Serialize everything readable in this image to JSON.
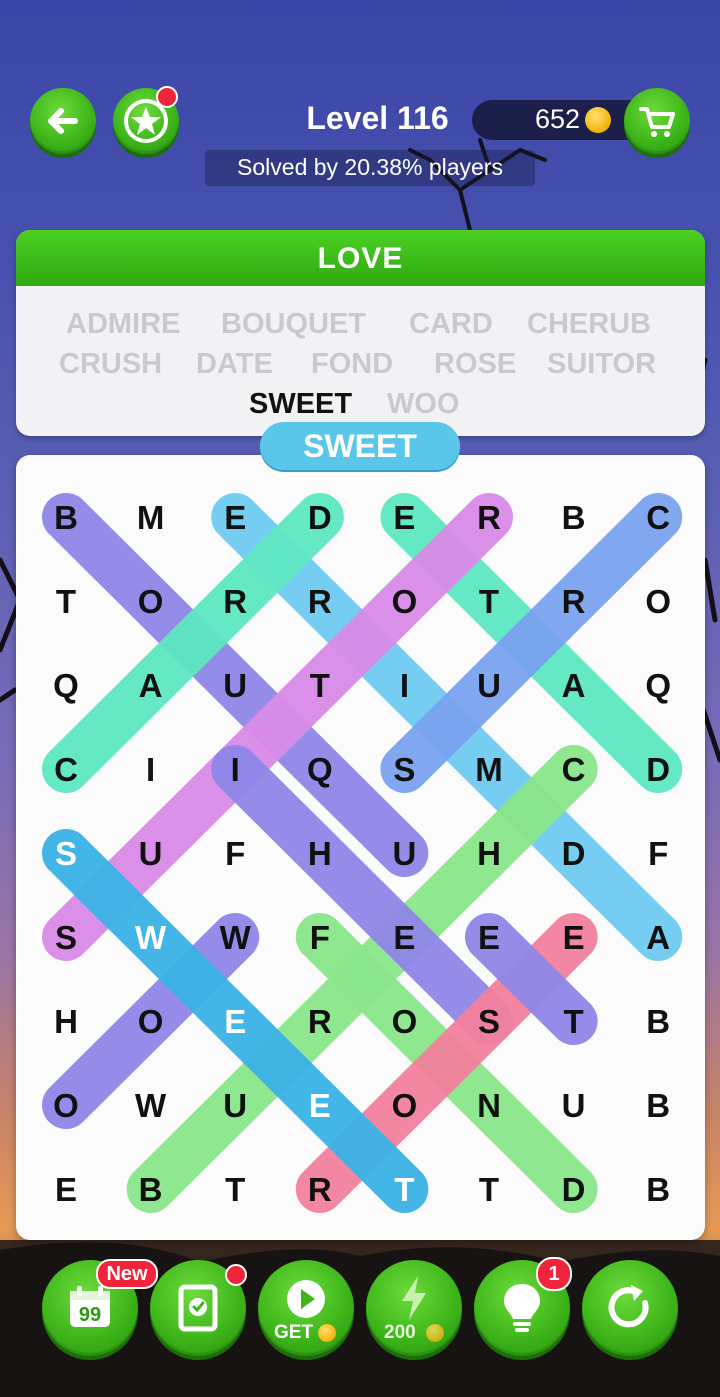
{
  "header": {
    "level_title": "Level 116",
    "coins": "652",
    "solved_text": "Solved by 20.38% players"
  },
  "category": "LOVE",
  "words": [
    {
      "text": "ADMIRE",
      "found": false
    },
    {
      "text": "BOUQUET",
      "found": false
    },
    {
      "text": "CARD",
      "found": false
    },
    {
      "text": "CHERUB",
      "found": false
    },
    {
      "text": "CRUSH",
      "found": false
    },
    {
      "text": "DATE",
      "found": false
    },
    {
      "text": "FOND",
      "found": false
    },
    {
      "text": "ROSE",
      "found": false
    },
    {
      "text": "SUITOR",
      "found": false
    },
    {
      "text": "SWEET",
      "found": true
    },
    {
      "text": "WOO",
      "found": false
    }
  ],
  "current_word": "SWEET",
  "grid": [
    [
      "B",
      "M",
      "E",
      "D",
      "E",
      "R",
      "B",
      "C"
    ],
    [
      "T",
      "O",
      "R",
      "R",
      "O",
      "T",
      "R",
      "O"
    ],
    [
      "Q",
      "A",
      "U",
      "T",
      "I",
      "U",
      "A",
      "Q"
    ],
    [
      "C",
      "I",
      "I",
      "Q",
      "S",
      "M",
      "C",
      "D"
    ],
    [
      "S",
      "U",
      "F",
      "H",
      "U",
      "H",
      "D",
      "F"
    ],
    [
      "S",
      "W",
      "W",
      "F",
      "E",
      "E",
      "E",
      "A"
    ],
    [
      "H",
      "O",
      "E",
      "R",
      "O",
      "S",
      "T",
      "B"
    ],
    [
      "O",
      "W",
      "U",
      "E",
      "O",
      "N",
      "U",
      "B"
    ],
    [
      "E",
      "B",
      "T",
      "R",
      "T",
      "T",
      "D",
      "B"
    ]
  ],
  "highlights": [
    {
      "from": [
        0,
        0
      ],
      "to": [
        4,
        4
      ],
      "color": "#8f87e8"
    },
    {
      "from": [
        0,
        2
      ],
      "to": [
        5,
        7
      ],
      "color": "#6fcbf2"
    },
    {
      "from": [
        0,
        4
      ],
      "to": [
        3,
        7
      ],
      "color": "#5ee8c2"
    },
    {
      "from": [
        0,
        7
      ],
      "to": [
        3,
        4
      ],
      "color": "#7aa3f0"
    },
    {
      "from": [
        0,
        3
      ],
      "to": [
        3,
        0
      ],
      "color": "#5ee8c2"
    },
    {
      "from": [
        0,
        5
      ],
      "to": [
        5,
        0
      ],
      "color": "#d98be8"
    },
    {
      "from": [
        3,
        6
      ],
      "to": [
        8,
        1
      ],
      "color": "#8ae68a"
    },
    {
      "from": [
        3,
        2
      ],
      "to": [
        6,
        5
      ],
      "color": "#8f87e8"
    },
    {
      "from": [
        5,
        3
      ],
      "to": [
        8,
        6
      ],
      "color": "#8ae68a"
    },
    {
      "from": [
        5,
        6
      ],
      "to": [
        8,
        3
      ],
      "color": "#f3819e"
    },
    {
      "from": [
        5,
        5
      ],
      "to": [
        6,
        6
      ],
      "color": "#8f87e8"
    },
    {
      "from": [
        5,
        2
      ],
      "to": [
        7,
        0
      ],
      "color": "#8f87e8"
    },
    {
      "from": [
        4,
        0
      ],
      "to": [
        8,
        4
      ],
      "color": "#3bb2e6"
    }
  ],
  "white_cells": [
    [
      4,
      0
    ],
    [
      5,
      1
    ],
    [
      6,
      2
    ],
    [
      7,
      3
    ],
    [
      8,
      4
    ]
  ],
  "bottom_bar": {
    "new_badge": "New",
    "hint_count": "1",
    "get_label": "GET",
    "boost_cost": "200"
  }
}
